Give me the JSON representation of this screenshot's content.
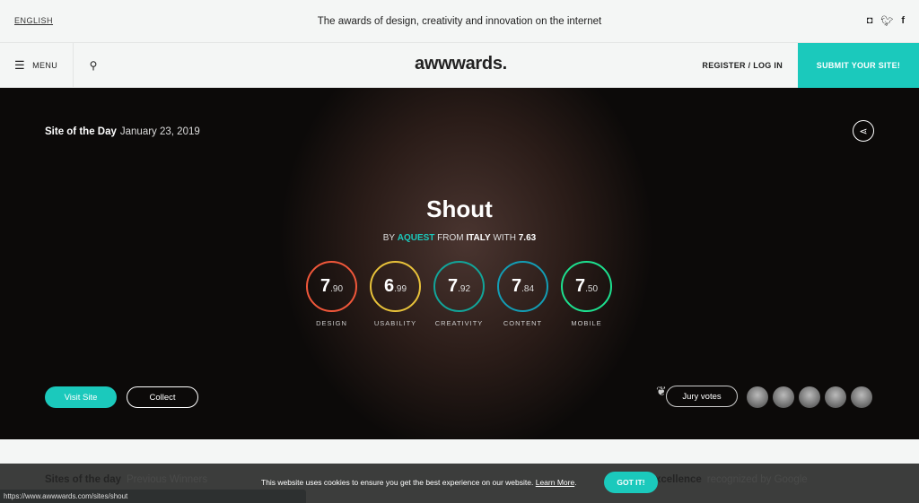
{
  "topbar": {
    "language": "ENGLISH",
    "tagline": "The awards of design, creativity and innovation on the internet",
    "social": [
      "instagram-icon",
      "twitter-icon",
      "facebook-icon"
    ]
  },
  "nav": {
    "menu": "MENU",
    "logo": "awwwards.",
    "register": "REGISTER / LOG IN",
    "submit": "SUBMIT YOUR SITE!"
  },
  "hero": {
    "badge": "Site of the Day",
    "date": "January 23, 2019",
    "title": "Shout",
    "by_prefix": "BY",
    "author": "AQUEST",
    "from": "FROM",
    "country": "ITALY",
    "with": "WITH",
    "overall": "7.63",
    "scores": [
      {
        "label": "DESIGN",
        "int": "7",
        "frac": ".90",
        "color": "#f0573a"
      },
      {
        "label": "USABILITY",
        "int": "6",
        "frac": ".99",
        "color": "#e8c23a"
      },
      {
        "label": "CREATIVITY",
        "int": "7",
        "frac": ".92",
        "color": "#12a59a"
      },
      {
        "label": "CONTENT",
        "int": "7",
        "frac": ".84",
        "color": "#139db5"
      },
      {
        "label": "MOBILE",
        "int": "7",
        "frac": ".50",
        "color": "#1de08f"
      }
    ],
    "visit": "Visit Site",
    "collect": "Collect",
    "jury": "Jury votes"
  },
  "sections": {
    "sites_of_day": "Sites of the day",
    "previous": "Previous Winners",
    "excellence": "xcellence",
    "google": "recognized by Google"
  },
  "cookie": {
    "text": "This website uses cookies to ensure you get the best experience on our website.",
    "link": "Learn More",
    "dot": ".",
    "button": "GOT IT!"
  },
  "status_url": "https://www.awwwards.com/sites/shout"
}
